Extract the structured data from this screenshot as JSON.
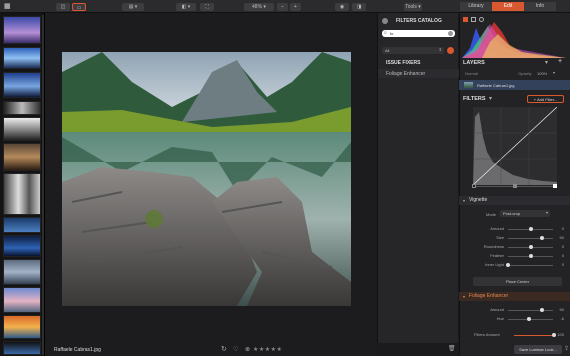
{
  "toolbar": {
    "zoom": "48%",
    "zoom_out": "–",
    "zoom_in": "+",
    "tools_label": "Tools",
    "tabs": [
      {
        "label": "Library",
        "active": false
      },
      {
        "label": "Edit",
        "active": true
      },
      {
        "label": "Info",
        "active": false
      }
    ]
  },
  "filters_catalog": {
    "title": "FILTERS CATALOG",
    "search_value": "fo",
    "category": "All",
    "group_label": "ISSUE FIXERS",
    "items": [
      "Foliage Enhancer"
    ]
  },
  "layers": {
    "title": "LAYERS",
    "blend_mode": "Normal",
    "opacity_label": "Opacity",
    "opacity_value": "100%",
    "layer_name": "Raffaele Cabras1.jpg"
  },
  "filters": {
    "title": "FILTERS",
    "add_filter_label": "+ Add Filter...",
    "vignette": {
      "title": "Vignette",
      "mode_label": "Mode",
      "mode_value": "Post-crop",
      "sliders": [
        {
          "label": "Amount",
          "value": "0",
          "level": 0.5
        },
        {
          "label": "Size",
          "value": "50",
          "level": 0.75
        },
        {
          "label": "Roundness",
          "value": "0",
          "level": 0.5
        },
        {
          "label": "Feather",
          "value": "0",
          "level": 0.5
        },
        {
          "label": "Inner Light",
          "value": "0",
          "level": 0.0
        }
      ],
      "place_center_label": "Place Center"
    },
    "foliage": {
      "title": "Foliage Enhancer",
      "sliders": [
        {
          "label": "Amount",
          "value": "50",
          "level": 0.75
        },
        {
          "label": "Hue",
          "value": "-6",
          "level": 0.47
        }
      ]
    },
    "filters_amount_label": "Filters Amount",
    "filters_amount_value": "100"
  },
  "status": {
    "filename": "Raffaele Cabras1.jpg",
    "rating_stars": "★★★★★",
    "save_look_label": "Save Luminar Look..."
  },
  "colors": {
    "accent": "#d9582f",
    "panel": "#232326"
  }
}
